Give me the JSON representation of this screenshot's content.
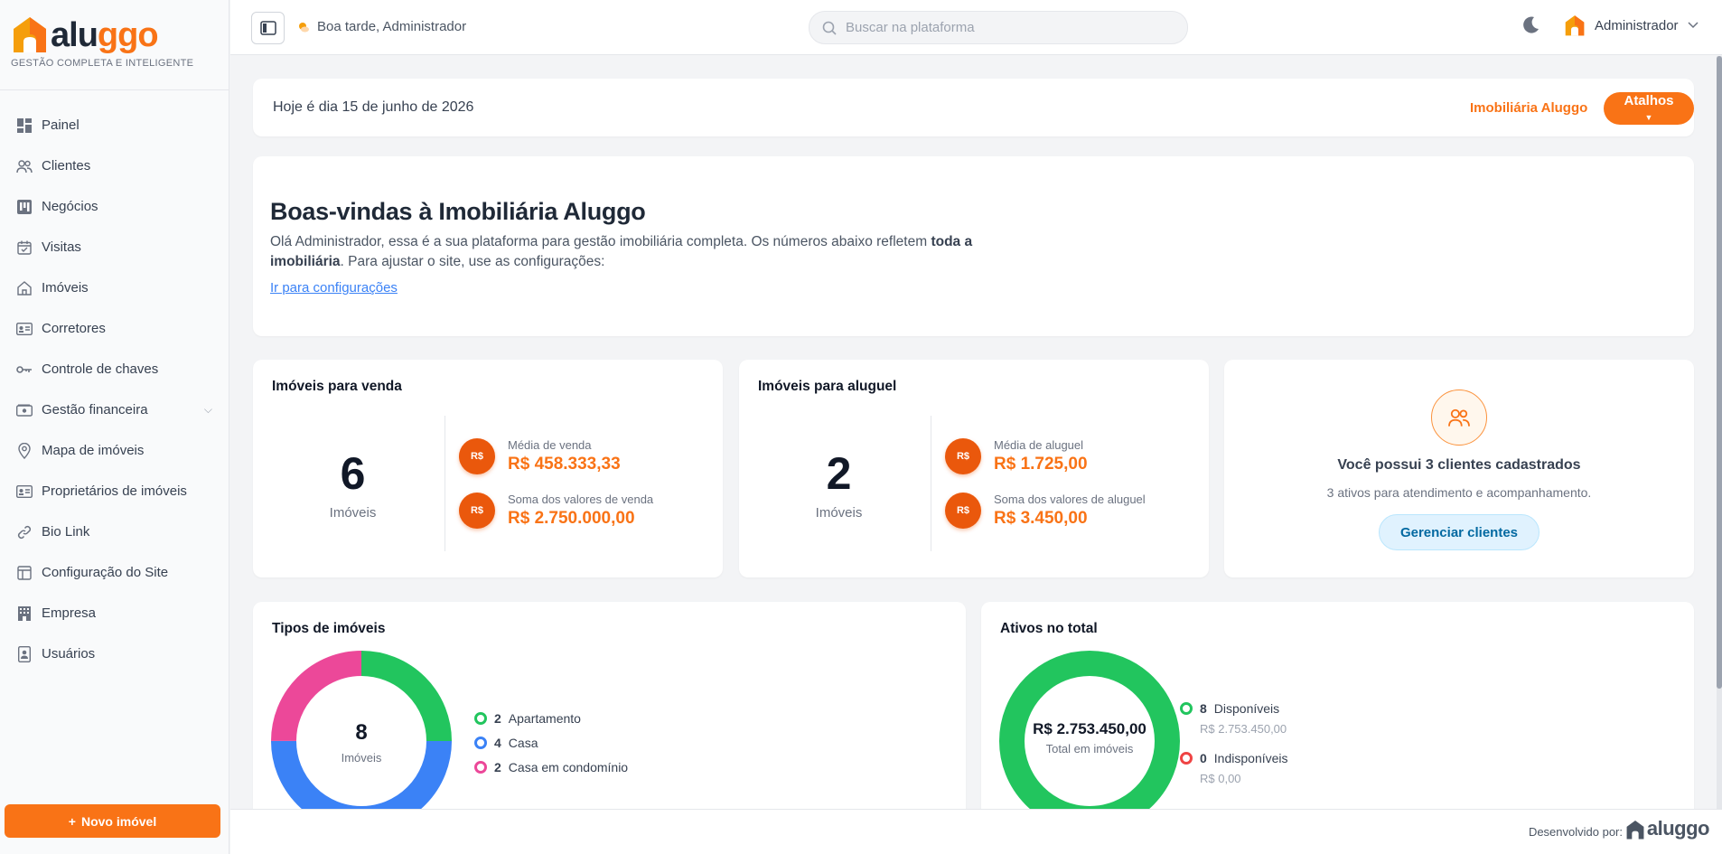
{
  "brand": {
    "logo_text_main": "alu",
    "logo_text_accent": "ggo",
    "tagline": "GESTÃO COMPLETA E INTELIGENTE",
    "accent": "#f97316"
  },
  "sidebar": {
    "items": [
      {
        "label": "Painel",
        "icon": "dashboard-icon"
      },
      {
        "label": "Clientes",
        "icon": "users-icon"
      },
      {
        "label": "Negócios",
        "icon": "kanban-icon"
      },
      {
        "label": "Visitas",
        "icon": "calendar-icon"
      },
      {
        "label": "Imóveis",
        "icon": "house-icon"
      },
      {
        "label": "Corretores",
        "icon": "id-card-icon"
      },
      {
        "label": "Controle de chaves",
        "icon": "key-icon"
      },
      {
        "label": "Gestão financeira",
        "icon": "wallet-icon"
      },
      {
        "label": "Mapa de imóveis",
        "icon": "map-pin-icon"
      },
      {
        "label": "Proprietários de imóveis",
        "icon": "owner-card-icon"
      },
      {
        "label": "Bio Link",
        "icon": "link-icon"
      },
      {
        "label": "Configuração do Site",
        "icon": "layout-icon"
      },
      {
        "label": "Empresa",
        "icon": "building-icon"
      },
      {
        "label": "Usuários",
        "icon": "user-badge-icon"
      }
    ],
    "new_button": "Novo imóvel"
  },
  "topbar": {
    "greeting": "Boa tarde, Administrador",
    "search_placeholder": "Buscar na plataforma",
    "user_name": "Administrador"
  },
  "datebar": {
    "date_text": "Hoje é dia 15 de junho de 2026",
    "agency": "Imobiliária Aluggo",
    "shortcuts": "Atalhos"
  },
  "welcome": {
    "title": "Boas-vindas à Imobiliária Aluggo",
    "text_before": "Olá Administrador, essa é a sua plataforma para gestão imobiliária completa. Os números abaixo refletem ",
    "text_bold": "toda a imobiliária",
    "text_after": ". Para ajustar o site, use as configurações:",
    "link": "Ir para configurações"
  },
  "sale": {
    "title": "Imóveis para venda",
    "count": "6",
    "count_label": "Imóveis",
    "avg_label": "Média de venda",
    "avg_value": "R$ 458.333,33",
    "sum_label": "Soma dos valores de venda",
    "sum_value": "R$ 2.750.000,00",
    "coin": "R$"
  },
  "rent": {
    "title": "Imóveis para aluguel",
    "count": "2",
    "count_label": "Imóveis",
    "avg_label": "Média de aluguel",
    "avg_value": "R$ 1.725,00",
    "sum_label": "Soma dos valores de aluguel",
    "sum_value": "R$ 3.450,00",
    "coin": "R$"
  },
  "clients": {
    "title": "Você possui 3 clientes cadastrados",
    "subtitle": "3 ativos para atendimento e acompanhamento.",
    "button": "Gerenciar clientes"
  },
  "types": {
    "title": "Tipos de imóveis",
    "center_value": "8",
    "center_label": "Imóveis",
    "items": [
      {
        "count": "2",
        "label": "Apartamento",
        "color": "#22c55e"
      },
      {
        "count": "4",
        "label": "Casa",
        "color": "#3b82f6"
      },
      {
        "count": "2",
        "label": "Casa em condomínio",
        "color": "#ec4899"
      }
    ]
  },
  "assets": {
    "title": "Ativos no total",
    "center_value": "R$ 2.753.450,00",
    "center_label": "Total em imóveis",
    "items": [
      {
        "count": "8",
        "label": "Disponíveis",
        "value": "R$ 2.753.450,00",
        "color": "#22c55e"
      },
      {
        "count": "0",
        "label": "Indisponíveis",
        "value": "R$ 0,00",
        "color": "#ef4444"
      }
    ]
  },
  "footer": {
    "developed_by": "Desenvolvido por:",
    "logo_text": "aluggo"
  },
  "chart_data": [
    {
      "type": "pie",
      "title": "Tipos de imóveis",
      "categories": [
        "Apartamento",
        "Casa",
        "Casa em condomínio"
      ],
      "values": [
        2,
        4,
        2
      ]
    },
    {
      "type": "pie",
      "title": "Ativos no total",
      "categories": [
        "Disponíveis",
        "Indisponíveis"
      ],
      "values": [
        8,
        0
      ]
    }
  ]
}
